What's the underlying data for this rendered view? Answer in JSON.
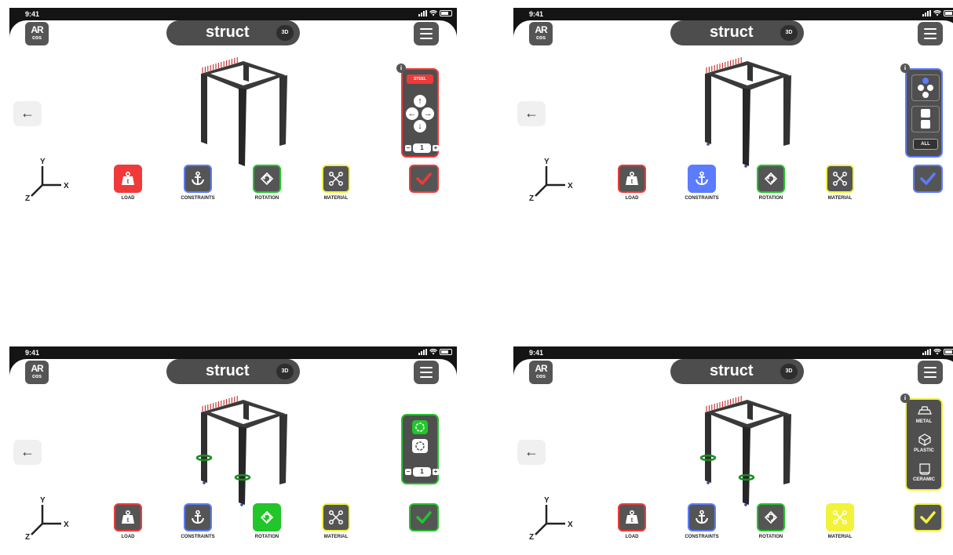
{
  "status": {
    "time": "9:41"
  },
  "header": {
    "title": "struct",
    "mode": "3D",
    "logo_top": "AR",
    "logo_bottom": "cos"
  },
  "axes": {
    "y": "Y",
    "x": "X",
    "z": "Z"
  },
  "tools": [
    {
      "label": "LOAD",
      "icon": "weight-icon"
    },
    {
      "label": "CONSTRAINTS",
      "icon": "anchor-icon"
    },
    {
      "label": "ROTATION",
      "icon": "rotate-icon"
    },
    {
      "label": "MATERIAL",
      "icon": "network-icon"
    }
  ],
  "colors": {
    "load": "#f03a3a",
    "constraints": "#5c7cff",
    "rotation": "#22c52a",
    "material": "#f2f23a",
    "inactive": "#555555"
  },
  "screens": [
    {
      "active": "LOAD",
      "panel": {
        "badge": "STEEL",
        "stepper_value": "1"
      }
    },
    {
      "active": "CONSTRAINTS",
      "panel": {
        "all_label": "ALL"
      }
    },
    {
      "active": "ROTATION",
      "panel": {
        "stepper_value": "1"
      }
    },
    {
      "active": "MATERIAL",
      "panel": {
        "materials": [
          "METAL",
          "PLASTIC",
          "CERAMIC"
        ]
      }
    }
  ]
}
